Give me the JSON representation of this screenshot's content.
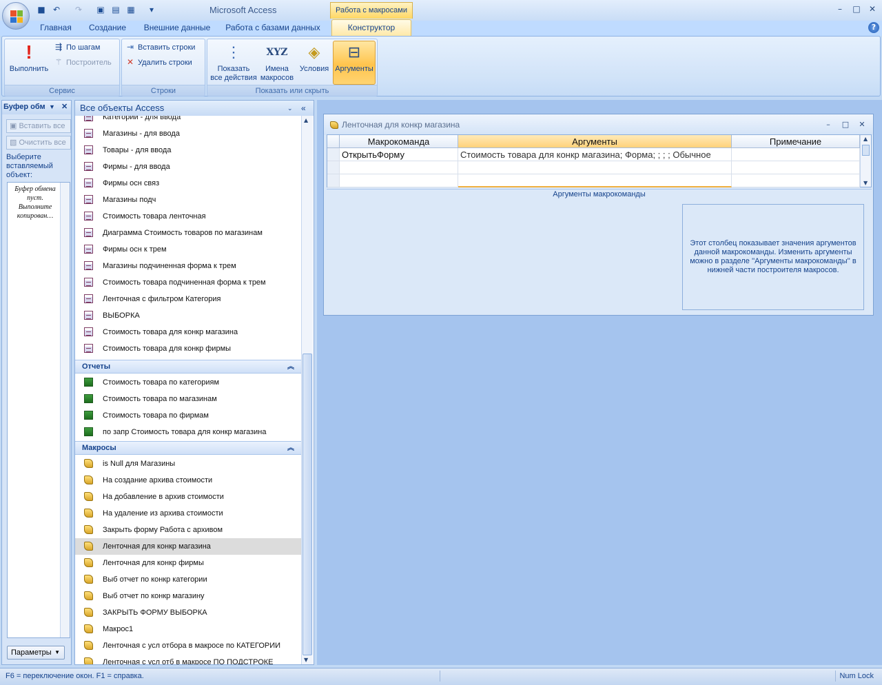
{
  "window": {
    "app_title": "Microsoft Access",
    "context_tab_group": "Работа с макросами",
    "controls": {
      "minimize": "–",
      "restore": "□",
      "close": "✕"
    }
  },
  "qat": {
    "save": "💾",
    "undo": "↶",
    "redo": "↷",
    "customize": "▾"
  },
  "tabs": [
    {
      "label": "Главная"
    },
    {
      "label": "Создание"
    },
    {
      "label": "Внешние данные"
    },
    {
      "label": "Работа с базами данных"
    },
    {
      "label": "Конструктор",
      "active": true
    }
  ],
  "help": "?",
  "ribbon": {
    "groups": [
      {
        "label": "Сервис"
      },
      {
        "label": "Строки"
      },
      {
        "label": "Показать или скрыть"
      }
    ],
    "run": "Выполнить",
    "step": "По шагам",
    "builder": "Построитель",
    "insert_rows": "Вставить строки",
    "delete_rows": "Удалить строки",
    "show_all_actions_1": "Показать",
    "show_all_actions_2": "все действия",
    "macro_names_1": "Имена",
    "macro_names_2": "макросов",
    "conditions": "Условия",
    "arguments": "Аргументы",
    "xyz": "XYZ"
  },
  "clipboard": {
    "title": "Буфер обм",
    "paste_all": "Вставить все",
    "clear_all": "Очистить все",
    "prompt": "Выберите вставляемый объект:",
    "empty_msg": "Буфер обмена пуст. Выполните копирован…",
    "options": "Параметры"
  },
  "nav": {
    "title": "Все объекты Access",
    "forms": [
      "Категории - для ввода",
      "Магазины - для ввода",
      "Товары - для ввода",
      "Фирмы - для ввода",
      "Фирмы осн связ",
      "Магазины подч",
      "Стоимость товара ленточная",
      "Диаграмма Стоимость товаров по  магазинам",
      "Фирмы осн к трем",
      "Магазины подчиненная форма к трем",
      "Стоимость товара подчиненная форма к трем",
      "Ленточная с фильтром Категория",
      "ВЫБОРКА",
      "Стоимость товара для конкр магазина",
      "Стоимость товара для конкр фирмы"
    ],
    "reports_header": "Отчеты",
    "reports": [
      "Стоимость товара по категориям",
      "Стоимость товара по магазинам",
      "Стоимость товара по фирмам",
      "по запр Стоимость товара для конкр магазина"
    ],
    "macros_header": "Макросы",
    "macros": [
      "is Null для Магазины",
      "На создание архива стоимости",
      "На добавление в архив стоимости",
      "На удаление из архива стоимости",
      "Закрыть форму Работа с архивом",
      "Ленточная для конкр магазина",
      "Ленточная для конкр фирмы",
      "Выб отчет по конкр категории",
      "Выб отчет по конкр магазину",
      "ЗАКРЫТЬ ФОРМУ ВЫБОРКА",
      "Макрос1",
      "Ленточная с усл отбора в макросе по КАТЕГОРИИ",
      "Ленточная с усл отб в макросе ПО ПОДСТРОКЕ"
    ],
    "selected_macro": "Ленточная для конкр магазина"
  },
  "macro_window": {
    "title": "Ленточная для конкр магазина",
    "columns": [
      "Макрокоманда",
      "Аргументы",
      "Примечание"
    ],
    "rows": [
      {
        "action": "ОткрытьФорму",
        "args": "Стоимость товара для конкр магазина; Форма; ; ; ; Обычное",
        "note": ""
      }
    ],
    "args_section": "Аргументы макрокоманды",
    "hint": "Этот столбец показывает значения аргументов данной макрокоманды. Изменить аргументы можно в разделе ''Аргументы макрокоманды'' в нижней части построителя макросов."
  },
  "status": {
    "left": "F6 = переключение окон.  F1 = справка.",
    "right": "Num Lock"
  }
}
